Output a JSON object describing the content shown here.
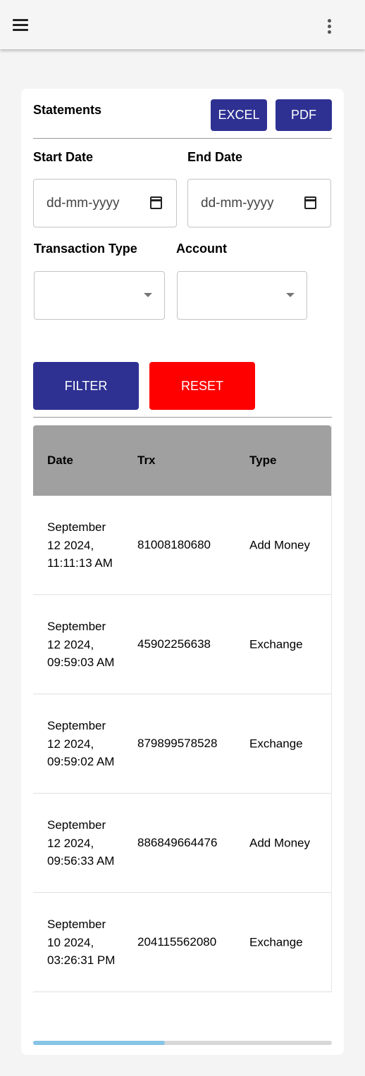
{
  "appbar": {
    "menu_icon": "hamburger-menu-icon",
    "more_icon": "more-vertical-icon"
  },
  "statements": {
    "title": "Statements",
    "excel_label": "EXCEL",
    "pdf_label": "PDF",
    "start_date_label": "Start Date",
    "end_date_label": "End Date",
    "start_date_placeholder": "dd-mm-yyyy",
    "end_date_placeholder": "dd-mm-yyyy",
    "transaction_type_label": "Transaction Type",
    "account_label": "Account",
    "transaction_type_value": "",
    "account_value": "",
    "filter_label": "FILTER",
    "reset_label": "RESET"
  },
  "table": {
    "headers": [
      "Date",
      "Trx",
      "Type"
    ],
    "rows": [
      {
        "date": "September 12 2024, 11:11:13 AM",
        "trx": "81008180680",
        "type": "Add Money"
      },
      {
        "date": "September 12 2024, 09:59:03 AM",
        "trx": "45902256638",
        "type": "Exchange"
      },
      {
        "date": "September 12 2024, 09:59:02 AM",
        "trx": "879899578528",
        "type": "Exchange"
      },
      {
        "date": "September 12 2024, 09:56:33 AM",
        "trx": "886849664476",
        "type": "Add Money"
      },
      {
        "date": "September 10 2024, 03:26:31 PM",
        "trx": "204115562080",
        "type": "Exchange"
      }
    ]
  },
  "scroll": {
    "position_fraction": 0.0,
    "visible_fraction": 0.44
  },
  "colors": {
    "primary": "#2e3192",
    "danger": "#ff0000",
    "header_bg": "#a0a0a0",
    "scroll_thumb": "#87c4e6"
  }
}
